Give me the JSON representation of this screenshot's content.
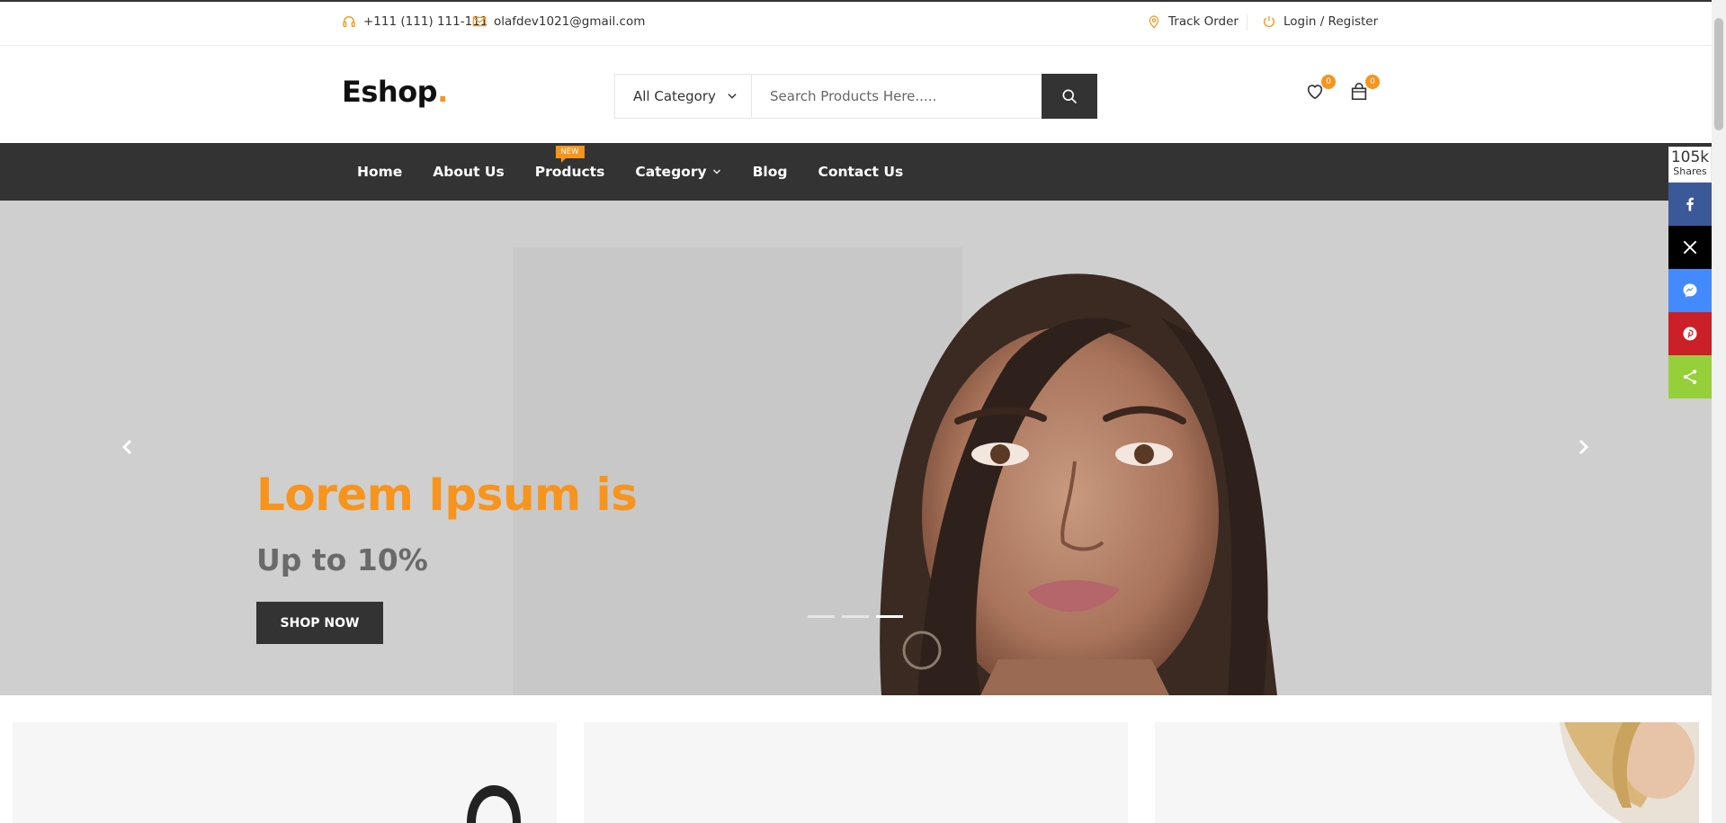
{
  "topbar": {
    "phone": "+111 (111) 111-111",
    "email": "olafdev1021@gmail.com",
    "track_order": "Track Order",
    "login_register": "Login / Register"
  },
  "header": {
    "logo_text": "Eshop",
    "logo_dot": ".",
    "category_select": "All Category",
    "search_placeholder": "Search Products Here.....",
    "wishlist_count": "0",
    "cart_count": "0"
  },
  "nav": {
    "items": [
      {
        "label": "Home"
      },
      {
        "label": "About Us"
      },
      {
        "label": "Products",
        "tag": "NEW"
      },
      {
        "label": "Category"
      },
      {
        "label": "Blog"
      },
      {
        "label": "Contact Us"
      }
    ]
  },
  "hero": {
    "title": "Lorem Ipsum is",
    "subtitle": "Up to 10%",
    "button": "SHOP NOW",
    "active_slide": 3,
    "slide_count": 3
  },
  "share": {
    "count": "105k",
    "label": "Shares",
    "networks": [
      "facebook-icon",
      "x-icon",
      "messenger-icon",
      "pinterest-icon",
      "share-icon"
    ]
  },
  "colors": {
    "accent": "#F7941D",
    "dark": "#333333",
    "facebook": "#3b5998",
    "x": "#000000",
    "messenger": "#448AFF",
    "pinterest": "#CB2027",
    "share": "#95D03A"
  }
}
